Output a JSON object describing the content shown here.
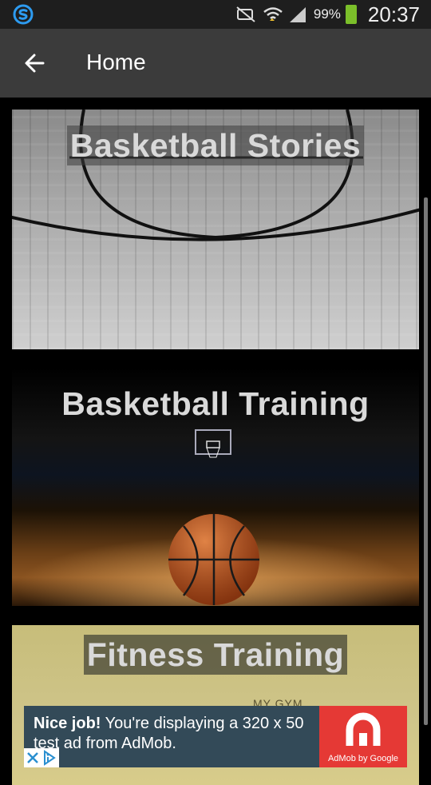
{
  "status_bar": {
    "battery": "99%",
    "time": "20:37"
  },
  "header": {
    "title": "Home"
  },
  "cards": [
    {
      "title": "Basketball Stories"
    },
    {
      "title": "Basketball Training"
    },
    {
      "title": "Fitness Training",
      "subtext": "MY GYM"
    }
  ],
  "ad": {
    "lead": "Nice job!",
    "body": "You're displaying a 320 x 50 test ad from AdMob.",
    "brand": "AdMob by Google"
  },
  "colors": {
    "action_bar": "#3b3b3b",
    "status_bar": "#1e1e1e",
    "ad_bg": "#334a58",
    "ad_logo": "#e53935",
    "battery": "#7bbf2a"
  }
}
